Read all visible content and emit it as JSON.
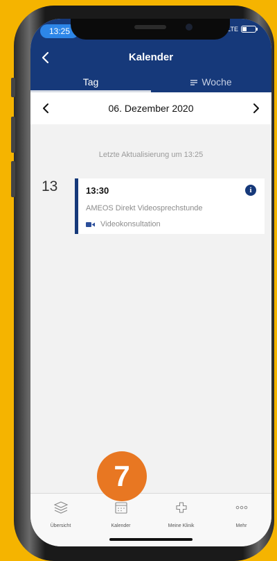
{
  "status_bar": {
    "time": "13:25",
    "network": "LTE"
  },
  "nav": {
    "title": "Kalender"
  },
  "tabs": [
    {
      "label": "Tag",
      "active": true
    },
    {
      "label": "Woche",
      "active": false
    }
  ],
  "date_nav": {
    "date": "06. Dezember 2020"
  },
  "last_update": "Letzte Aktualisierung um 13:25",
  "schedule": {
    "hour": "13",
    "event": {
      "time": "13:30",
      "info_icon": "i",
      "title": "AMEOS Direkt Videosprechstunde",
      "type": "Videokonsultation"
    }
  },
  "tabbar": [
    {
      "label": "Übersicht",
      "icon": "layers-icon"
    },
    {
      "label": "Kalender",
      "icon": "calendar-icon"
    },
    {
      "label": "Meine Klinik",
      "icon": "medical-cross-icon"
    },
    {
      "label": "Mehr",
      "icon": "more-dots-icon"
    }
  ],
  "step_badge": "7",
  "colors": {
    "brand": "#16397a",
    "background": "#F5B400",
    "badge": "#e87722"
  }
}
